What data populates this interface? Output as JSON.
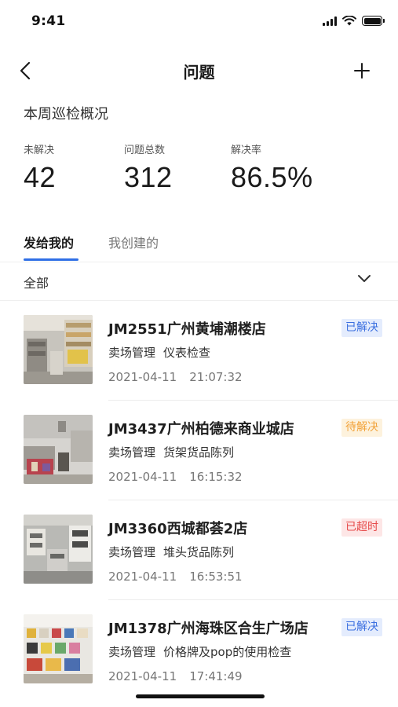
{
  "status_bar": {
    "time": "9:41",
    "icons": [
      "signal-icon",
      "wifi-icon",
      "battery-icon"
    ]
  },
  "nav": {
    "title": "问题",
    "back_icon": "chevron-left-icon",
    "add_icon": "plus-icon"
  },
  "summary": {
    "title": "本周巡检概况",
    "stats": [
      {
        "label": "未解决",
        "value": "42"
      },
      {
        "label": "问题总数",
        "value": "312"
      },
      {
        "label": "解决率",
        "value": "86.5%"
      }
    ]
  },
  "tabs": [
    {
      "label": "发给我的",
      "active": true
    },
    {
      "label": "我创建的",
      "active": false
    }
  ],
  "filter": {
    "label": "全部",
    "icon": "chevron-down-icon"
  },
  "colors": {
    "accent": "#2f6fe6",
    "resolved": "#3b6fe0",
    "pending": "#f2a33a",
    "overdue": "#e64a4a"
  },
  "issues": [
    {
      "store": "JM2551广州黄埔潮楼店",
      "category": "卖场管理",
      "item": "仪表检查",
      "date": "2021-04-11",
      "time": "21:07:32",
      "status": "已解决",
      "status_type": "resolved"
    },
    {
      "store": "JM3437广州柏德来商业城店",
      "category": "卖场管理",
      "item": "货架货品陈列",
      "date": "2021-04-11",
      "time": "16:15:32",
      "status": "待解决",
      "status_type": "pending"
    },
    {
      "store": "JM3360西城都荟2店",
      "category": "卖场管理",
      "item": "堆头货品陈列",
      "date": "2021-04-11",
      "time": "16:53:51",
      "status": "已超时",
      "status_type": "overdue"
    },
    {
      "store": "JM1378广州海珠区合生广场店",
      "category": "卖场管理",
      "item": "价格牌及pop的使用检查",
      "date": "2021-04-11",
      "time": "17:41:49",
      "status": "已解决",
      "status_type": "resolved"
    }
  ]
}
